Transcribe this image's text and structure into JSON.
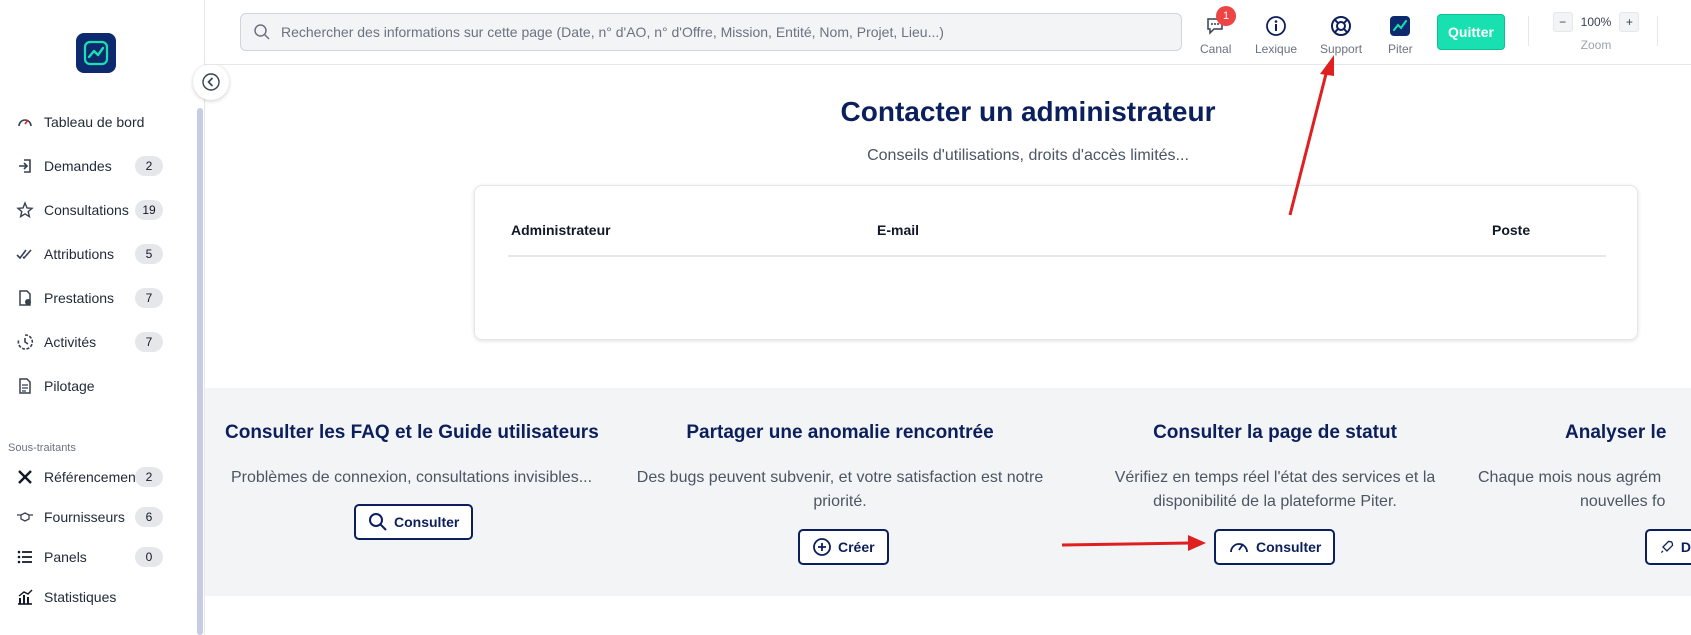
{
  "search": {
    "placeholder": "Rechercher des informations sur cette page (Date, n° d'AO, n° d'Offre, Mission, Entité, Nom, Projet, Lieu...)"
  },
  "toolbar": {
    "canal_label": "Canal",
    "canal_badge": "1",
    "lexique_label": "Lexique",
    "support_label": "Support",
    "piter_label": "Piter",
    "quit_label": "Quitter",
    "zoom_minus": "−",
    "zoom_value": "100%",
    "zoom_plus": "+",
    "zoom_label": "Zoom"
  },
  "sidebar": {
    "items": [
      {
        "label": "Tableau de bord",
        "badge": ""
      },
      {
        "label": "Demandes",
        "badge": "2"
      },
      {
        "label": "Consultations",
        "badge": "19"
      },
      {
        "label": "Attributions",
        "badge": "5"
      },
      {
        "label": "Prestations",
        "badge": "7"
      },
      {
        "label": "Activités",
        "badge": "7"
      },
      {
        "label": "Pilotage",
        "badge": ""
      }
    ],
    "section_label": "Sous-traitants",
    "items2": [
      {
        "label": "Référencements",
        "badge": "2"
      },
      {
        "label": "Fournisseurs",
        "badge": "6"
      },
      {
        "label": "Panels",
        "badge": "0"
      },
      {
        "label": "Statistiques",
        "badge": ""
      }
    ]
  },
  "main": {
    "title": "Contacter un administrateur",
    "subtitle": "Conseils d'utilisations, droits d'accès limités...",
    "table": {
      "headers": [
        "Administrateur",
        "E-mail",
        "Poste"
      ]
    }
  },
  "sections": [
    {
      "title": "Consulter les FAQ et le Guide utilisateurs",
      "line1": "Problèmes de connexion, consultations invisibles...",
      "line2": "",
      "button": "Consulter"
    },
    {
      "title": "Partager une anomalie rencontrée",
      "line1": "Des bugs peuvent subvenir, et votre satisfaction est notre",
      "line2": "priorité.",
      "button": "Créer"
    },
    {
      "title": "Consulter la page de statut",
      "line1": "Vérifiez en temps réel l'état des services et la",
      "line2": "disponibilité de la plateforme Piter.",
      "button": "Consulter"
    },
    {
      "title": "Analyser le",
      "line1": "Chaque mois nous agrém",
      "line2": "nouvelles fo",
      "button": "D"
    }
  ],
  "colors": {
    "navy": "#0b1f5c",
    "accent": "#19e0b0",
    "annotation": "#e02020"
  }
}
